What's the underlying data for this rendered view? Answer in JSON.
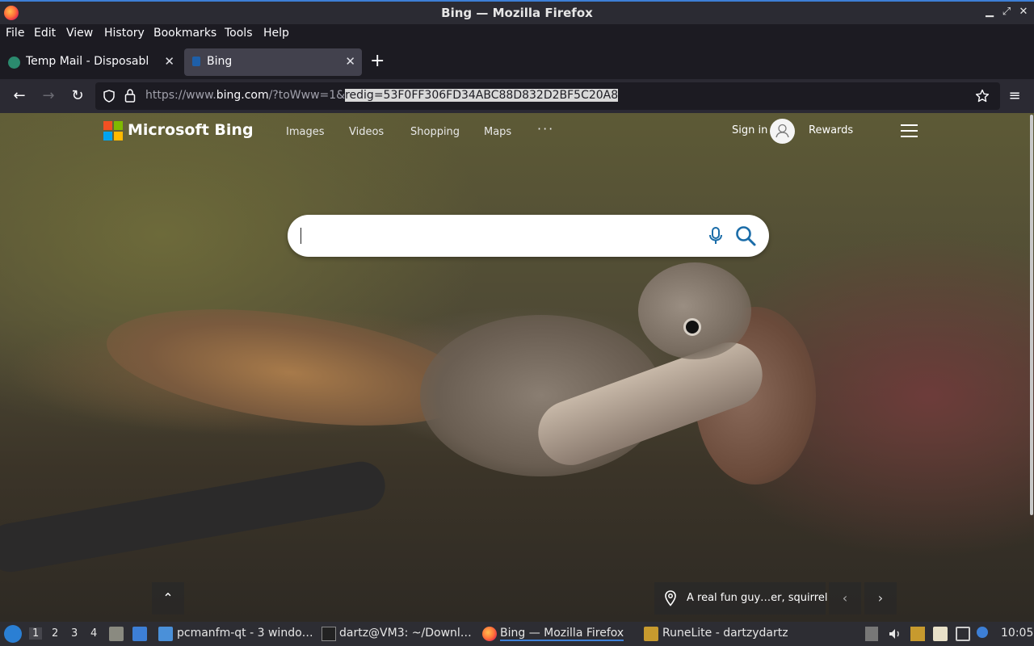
{
  "window": {
    "title": "Bing — Mozilla Firefox",
    "minimize": "▁",
    "maximize": "⤢",
    "close": "✕"
  },
  "menu": [
    "File",
    "Edit",
    "View",
    "History",
    "Bookmarks",
    "Tools",
    "Help"
  ],
  "tabs": [
    {
      "label": "Temp Mail - Disposable Te",
      "favicon": "tempmail-icon",
      "active": false
    },
    {
      "label": "Bing",
      "favicon": "bing-icon",
      "active": true
    }
  ],
  "tab_close": "✕",
  "new_tab": "+",
  "navbar": {
    "back": "←",
    "forward": "→",
    "reload": "↻",
    "url_prefix": "https://www.",
    "url_host": "bing.com",
    "url_path": "/?toWww=1&",
    "url_selected": "redig=53F0FF306FD34ABC88D832D2BF5C20A8",
    "menu": "≡"
  },
  "bing": {
    "brand": "Microsoft Bing",
    "nav": [
      "Images",
      "Videos",
      "Shopping",
      "Maps"
    ],
    "more": "···",
    "sign_in": "Sign in",
    "rewards": "Rewards",
    "search_value": "",
    "caption": "A real fun guy…er, squirrel",
    "scroll_up": "⌃",
    "prev": "‹",
    "next": "›"
  },
  "colors": {
    "logo_red": "#f25022",
    "logo_green": "#7fba00",
    "logo_blue": "#00a4ef",
    "logo_yellow": "#ffb900",
    "search_icon": "#1a6ca8"
  },
  "taskbar": {
    "workspaces": [
      "1",
      "2",
      "3",
      "4"
    ],
    "tasks": [
      {
        "label": "pcmanfm-qt - 3 windo…",
        "icon": "folder-icon"
      },
      {
        "label": "dartz@VM3: ~/Downl…",
        "icon": "terminal-icon"
      },
      {
        "label": "Bing — Mozilla Firefox",
        "icon": "firefox-icon",
        "active": true
      },
      {
        "label": "RuneLite - dartzydartz",
        "icon": "runelite-icon"
      }
    ],
    "clock": "10:05"
  }
}
